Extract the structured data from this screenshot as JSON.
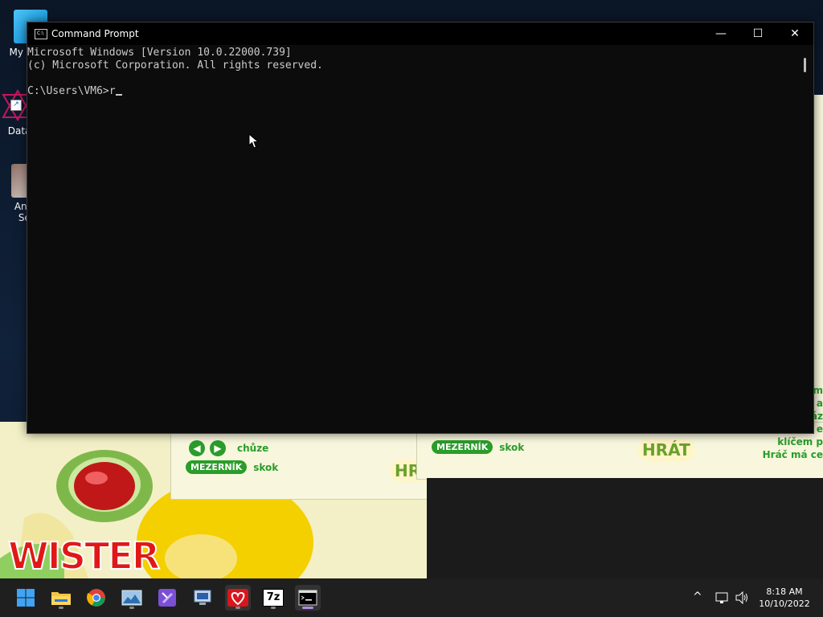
{
  "desktop": {
    "icons": [
      {
        "label": "My Co",
        "icon": "computer-icon"
      },
      {
        "label": "DataW",
        "icon": "datawrapper-icon"
      },
      {
        "label": "Angr",
        "label2": "Sea",
        "icon": "angry-game-icon"
      }
    ]
  },
  "game_windows": {
    "left": {
      "logo_text": "WISTER"
    },
    "middle": {
      "walk_label": "chůze",
      "space_key": "MEZERNÍK",
      "jump_label": "skok",
      "play_button": "HRÁT"
    },
    "right": {
      "space_key": "MEZERNÍK",
      "jump_label": "skok",
      "play_button": "HRÁT",
      "side_text": [
        "m",
        "a",
        "áz",
        "e",
        "klíčem p",
        "Hráč má ce"
      ]
    }
  },
  "cmd": {
    "title": "Command Prompt",
    "lines": [
      "Microsoft Windows [Version 10.0.22000.739]",
      "(c) Microsoft Corporation. All rights reserved.",
      ""
    ],
    "prompt": "C:\\Users\\VM6>",
    "typed": "r",
    "window_controls": {
      "minimize": "—",
      "maximize": "☐",
      "close": "✕"
    }
  },
  "taskbar": {
    "apps": [
      {
        "name": "start-button",
        "icon": "windows-logo-icon"
      },
      {
        "name": "file-explorer",
        "icon": "folder-icon"
      },
      {
        "name": "chrome",
        "icon": "chrome-icon"
      },
      {
        "name": "photos",
        "icon": "image-icon"
      },
      {
        "name": "visual-studio",
        "icon": "vs-icon"
      },
      {
        "name": "remote-desktop",
        "icon": "monitor-app-icon"
      },
      {
        "name": "heart-game",
        "icon": "heart-icon"
      },
      {
        "name": "7zip",
        "icon": "7zip-icon",
        "text": "7z"
      },
      {
        "name": "command-prompt",
        "icon": "terminal-icon"
      }
    ],
    "time": "8:18 AM",
    "date": "10/10/2022"
  }
}
